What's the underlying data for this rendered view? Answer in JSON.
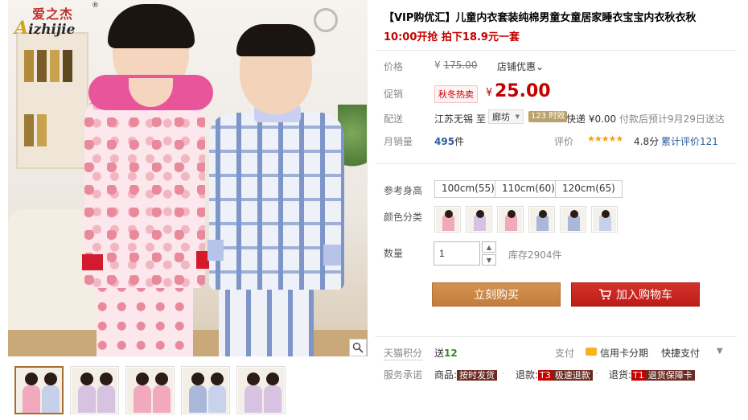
{
  "brand": {
    "name_cn": "爱之杰",
    "name_en_cap": "A",
    "name_en_rest": "izhijie",
    "reg_mark": "®"
  },
  "product": {
    "title": "【VIP购优汇】儿童内衣套装纯棉男童女童居家睡衣宝宝内衣秋衣秋",
    "subtitle": "10:00开抢 拍下18.9元一套"
  },
  "price": {
    "label": "价格",
    "currency": "¥",
    "original": "175.00",
    "shop_discount": "店铺优惠"
  },
  "promo": {
    "label": "促销",
    "tag": "秋冬热卖",
    "currency": "¥",
    "price": "25.00"
  },
  "delivery": {
    "label": "配送",
    "from": "江苏无锡",
    "to_word": "至",
    "city": "廊坊",
    "timing_tag": "123 时效",
    "info_main": "快递 ¥0.00",
    "info_muted": "付款后预计9月29日送达"
  },
  "sales": {
    "label": "月销量",
    "count": "495",
    "unit": "件",
    "rating_label": "评价",
    "stars": "★★★★★",
    "rating": "4.8分",
    "review_link": "累计评价121"
  },
  "options": {
    "height_label": "参考身高",
    "heights": [
      "100cm(55)",
      "110cm(60)",
      "120cm(65)"
    ],
    "color_label": "颜色分类",
    "swatches": [
      {
        "body": "#f1a9bd"
      },
      {
        "body": "#d8c2e2"
      },
      {
        "body": "#f1a9bd"
      },
      {
        "body": "#a9b7d9"
      },
      {
        "body": "#a9b7d9"
      },
      {
        "body": "#c6d0ea"
      }
    ]
  },
  "quantity": {
    "label": "数量",
    "value": "1",
    "stock": "库存2904件"
  },
  "buttons": {
    "buy_now": "立刻购买",
    "add_cart": "加入购物车"
  },
  "points": {
    "label": "天猫积分",
    "prefix": "送",
    "value": "12",
    "pay_label": "支付",
    "installment": "信用卡分期",
    "quick_pay": "快捷支付"
  },
  "service": {
    "label": "服务承诺",
    "item1_prefix": "商品:",
    "item1_tag": "按时发货",
    "item2_prefix": "退款:",
    "item2_code": "T3",
    "item2_tag": "极速退款",
    "item3_prefix": "退货:",
    "item3_code": "T1",
    "item3_tag": "退货保障卡"
  },
  "thumbnails": [
    {
      "kid1": "#f1a9bd",
      "kid2": "#c6d0ea"
    },
    {
      "kid1": "#d8c2e2",
      "kid2": "#d8c2e2"
    },
    {
      "kid1": "#f1a9bd",
      "kid2": "#f1a9bd"
    },
    {
      "kid1": "#a9b7d9",
      "kid2": "#c8d2ec"
    },
    {
      "kid1": "#d8c2e2",
      "kid2": "#d8c2e2"
    }
  ],
  "colors": {
    "accent_red": "#c40000",
    "buy_orange": "#c98744",
    "cart_red": "#c4241e"
  }
}
